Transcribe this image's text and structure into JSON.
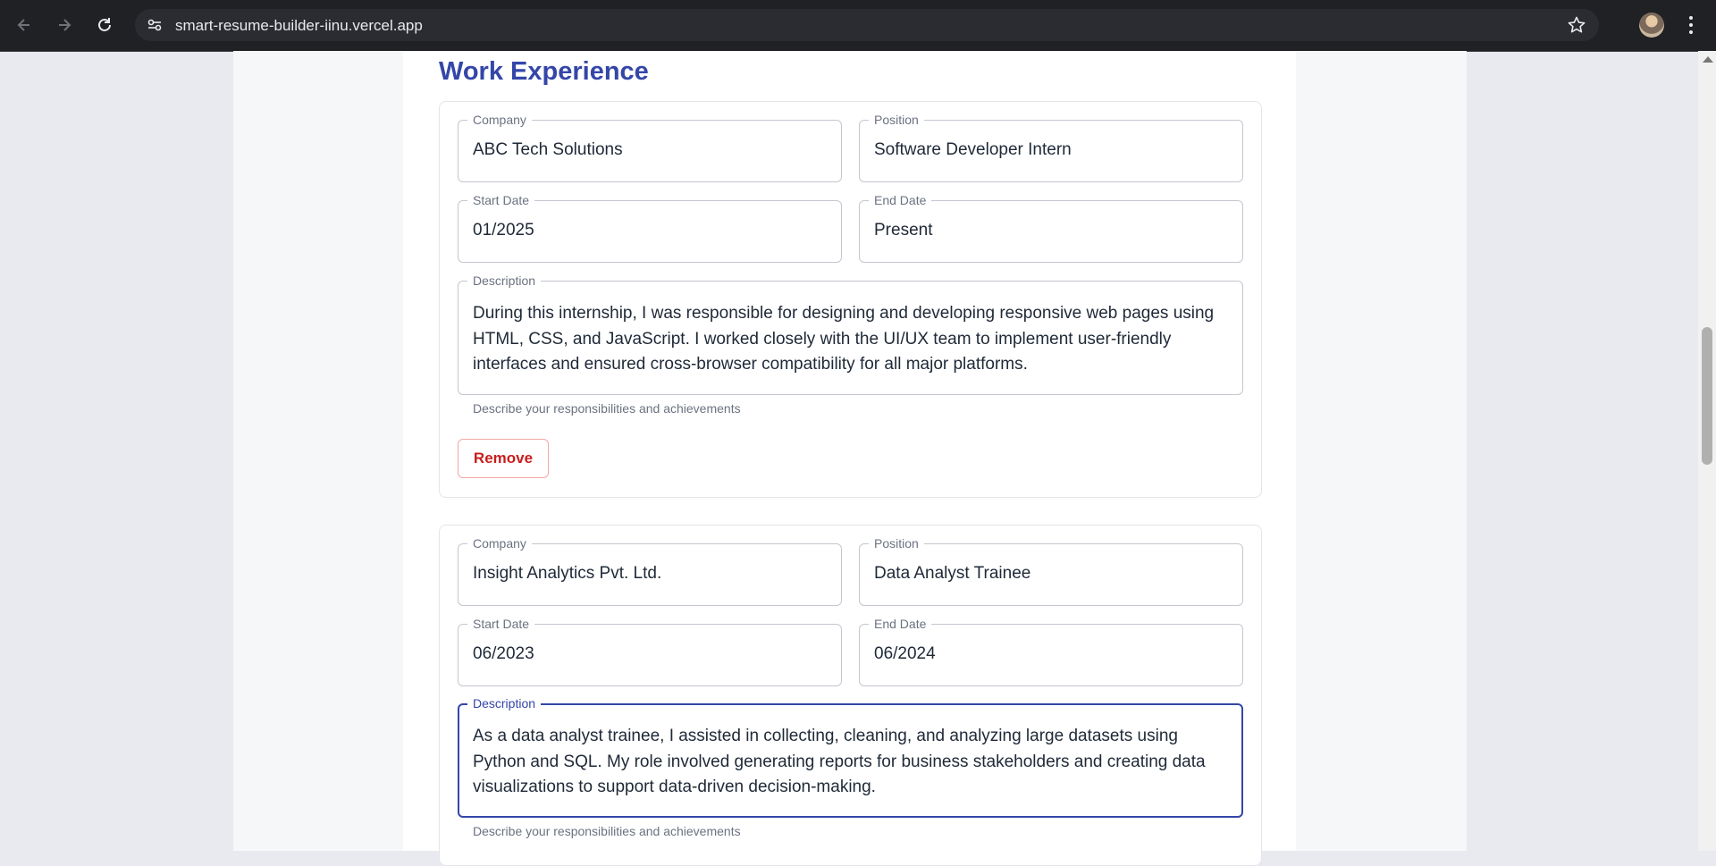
{
  "browser": {
    "url": "smart-resume-builder-iinu.vercel.app",
    "icons": [
      "back-icon",
      "forward-icon",
      "reload-icon",
      "site-info-icon",
      "bookmark-star-icon",
      "profile-avatar",
      "more-menu-icon"
    ]
  },
  "section": {
    "title": "Work Experience"
  },
  "experience": [
    {
      "company_label": "Company",
      "company": "ABC Tech Solutions",
      "position_label": "Position",
      "position": "Software Developer Intern",
      "start_label": "Start Date",
      "start": "01/2025",
      "end_label": "End Date",
      "end": "Present",
      "description_label": "Description",
      "description": "During this internship, I was responsible for designing and developing responsive web pages using HTML, CSS, and JavaScript. I worked closely with the UI/UX team to implement user-friendly interfaces and ensured cross-browser compatibility for all major platforms.",
      "helper": "Describe your responsibilities and achievements",
      "remove_label": "Remove"
    },
    {
      "company_label": "Company",
      "company": "Insight Analytics Pvt. Ltd.",
      "position_label": "Position",
      "position": "Data Analyst Trainee",
      "start_label": "Start Date",
      "start": "06/2023",
      "end_label": "End Date",
      "end": "06/2024",
      "description_label": "Description",
      "description": "As a data analyst trainee, I assisted in collecting, cleaning, and analyzing large datasets using Python and SQL. My role involved generating reports for business stakeholders and creating data visualizations to support data-driven decision-making.",
      "helper": "Describe your responsibilities and achievements",
      "focused_field": "description"
    }
  ],
  "colors": {
    "accent": "#3446a8",
    "danger": "#c81e1e",
    "chrome": "#202124"
  }
}
